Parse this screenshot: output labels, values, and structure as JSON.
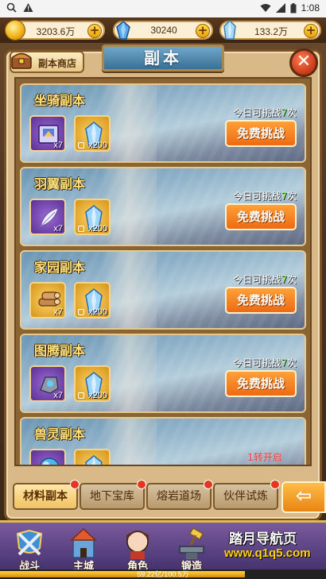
{
  "statusbar": {
    "time": "1:08"
  },
  "resources": [
    {
      "icon": "coin-icon",
      "value": "3203.6万"
    },
    {
      "icon": "blue-crystal-icon",
      "value": "30240"
    },
    {
      "icon": "ice-crystal-icon",
      "value": "133.2万"
    }
  ],
  "title": "副本",
  "shop": {
    "label": "副本商店"
  },
  "dungeons": [
    {
      "title": "坐骑副本",
      "item_icon": "mount-book-icon",
      "item_qty": "x7",
      "crystal_qty": "x200",
      "limit_prefix": "今日可挑战",
      "limit_count": "7",
      "limit_suffix": "次",
      "button": "免费挑战"
    },
    {
      "title": "羽翼副本",
      "item_icon": "feather-icon",
      "item_qty": "x7",
      "crystal_qty": "x200",
      "limit_prefix": "今日可挑战",
      "limit_count": "7",
      "limit_suffix": "次",
      "button": "免费挑战"
    },
    {
      "title": "家园副本",
      "item_icon": "wood-logs-icon",
      "item_qty": "x7",
      "crystal_qty": "x200",
      "limit_prefix": "今日可挑战",
      "limit_count": "7",
      "limit_suffix": "次",
      "button": "免费挑战"
    },
    {
      "title": "图腾副本",
      "item_icon": "totem-stone-icon",
      "item_qty": "x7",
      "crystal_qty": "x200",
      "limit_prefix": "今日可挑战",
      "limit_count": "7",
      "limit_suffix": "次",
      "button": "免费挑战"
    },
    {
      "title": "兽灵副本",
      "item_icon": "spirit-orb-icon",
      "unlock_text": "1转开启"
    }
  ],
  "tabs": [
    {
      "label": "材料副本",
      "active": true
    },
    {
      "label": "地下宝库",
      "active": false
    },
    {
      "label": "熔岩道场",
      "active": false
    },
    {
      "label": "伙伴试炼",
      "active": false
    }
  ],
  "nav": [
    {
      "label": "战斗",
      "icon": "sword-shield-icon"
    },
    {
      "label": "主城",
      "icon": "castle-icon"
    },
    {
      "label": "角色",
      "icon": "hero-portrait-icon"
    },
    {
      "label": "锻造",
      "icon": "anvil-hammer-icon"
    }
  ],
  "exp": {
    "text": "59.22亿/100.5万",
    "progress": 0.75
  },
  "watermark": {
    "line1": "踏月导航页",
    "line2": "www.q1q5.com"
  }
}
